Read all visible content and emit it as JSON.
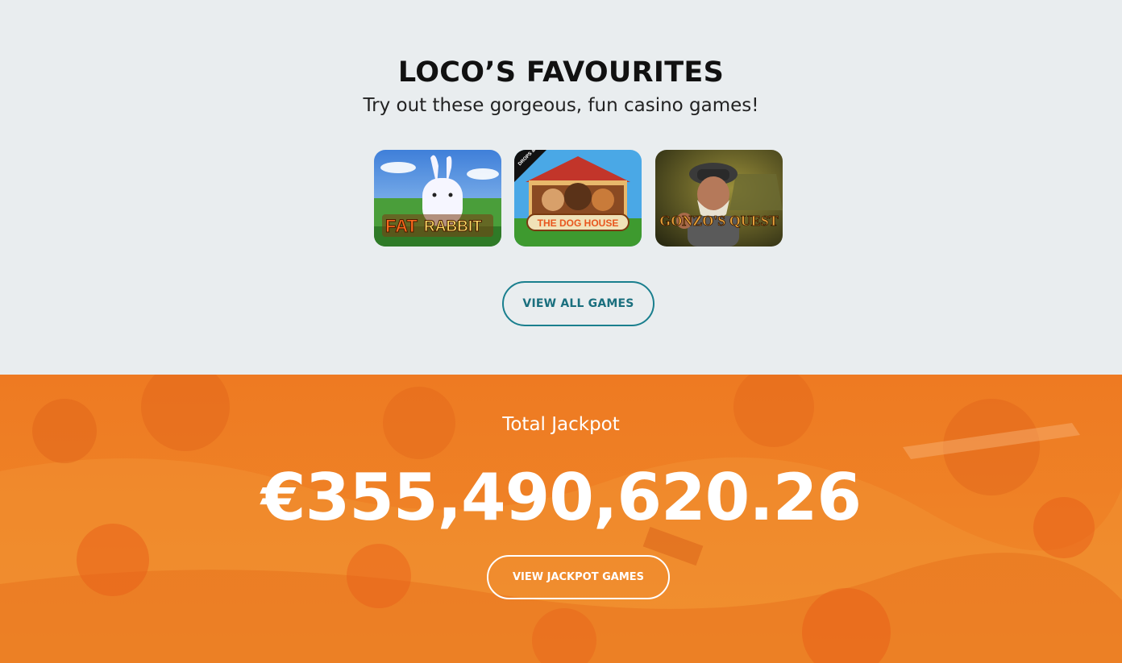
{
  "favourites": {
    "title": "LOCO’S FAVOURITES",
    "subtitle": "Try out these gorgeous, fun casino games!",
    "games": [
      {
        "name": "Fat Rabbit",
        "logo_text_1": "FAT",
        "logo_text_2": "RABBIT"
      },
      {
        "name": "The Dog House",
        "logo_text": "THE DOG HOUSE",
        "badge": "DROPS & WINS"
      },
      {
        "name": "Gonzo's Quest",
        "logo_text": "GONZO'S QUEST"
      }
    ],
    "view_all_label": "VIEW ALL GAMES",
    "accent_color": "#1a7f8e"
  },
  "jackpot": {
    "label": "Total Jackpot",
    "amount": "€355,490,620.26",
    "button_label": "VIEW JACKPOT GAMES",
    "background_color": "#f07a1e"
  }
}
